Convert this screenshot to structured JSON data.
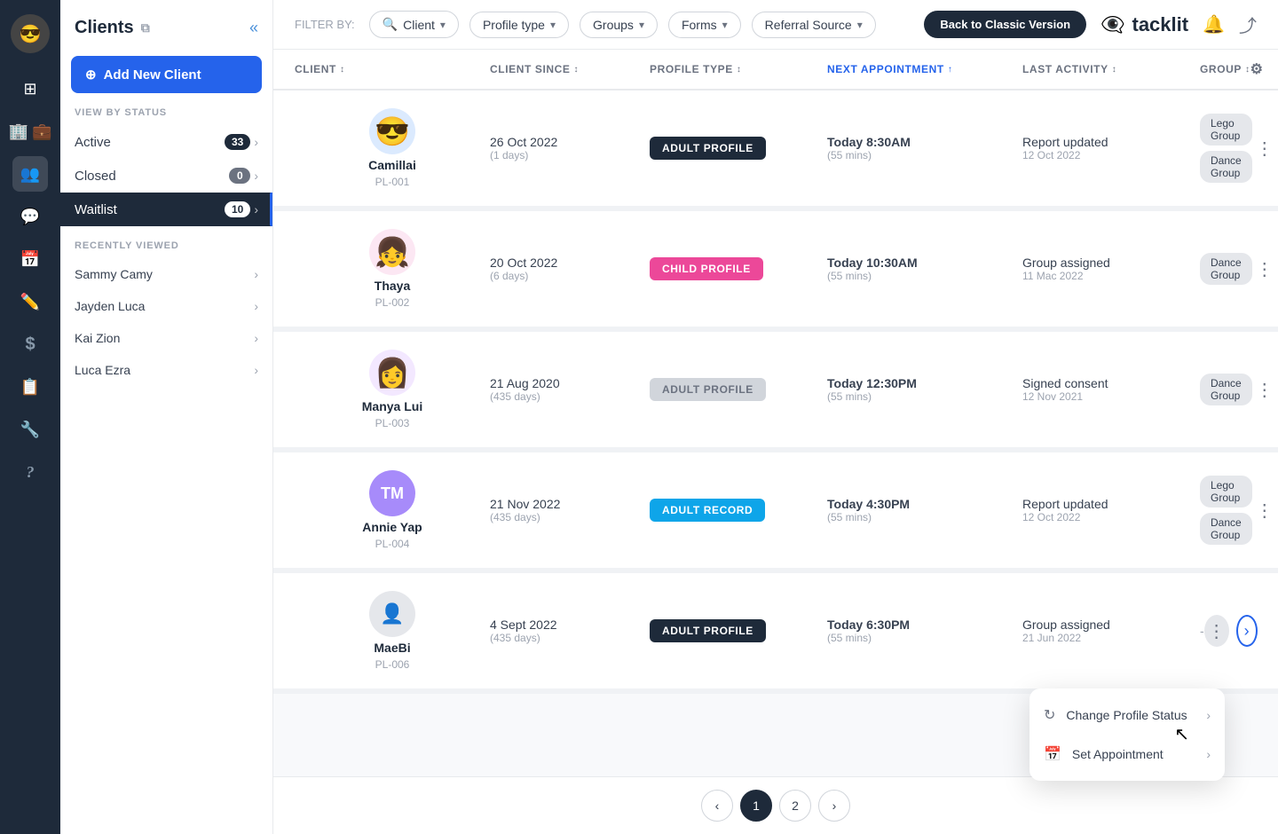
{
  "brand": {
    "name": "tacklit",
    "icon": "👁"
  },
  "nav": {
    "avatar_initial": "😎",
    "icons": [
      {
        "name": "grid-icon",
        "glyph": "⊞",
        "active": false
      },
      {
        "name": "briefcase-icon",
        "glyph": "💼",
        "active": false
      },
      {
        "name": "people-icon",
        "glyph": "👥",
        "active": true
      },
      {
        "name": "chat-icon",
        "glyph": "💬",
        "active": false
      },
      {
        "name": "calendar-icon",
        "glyph": "📅",
        "active": false
      },
      {
        "name": "pencil-icon",
        "glyph": "✏️",
        "active": false
      },
      {
        "name": "dollar-icon",
        "glyph": "$",
        "active": false
      },
      {
        "name": "list-icon",
        "glyph": "📋",
        "active": false
      },
      {
        "name": "wrench-icon",
        "glyph": "🔧",
        "active": false
      },
      {
        "name": "help-icon",
        "glyph": "?",
        "active": false
      }
    ]
  },
  "sidebar": {
    "title": "Clients",
    "add_button_label": "Add New Client",
    "view_by_status_label": "VIEW BY STATUS",
    "statuses": [
      {
        "label": "Active",
        "count": 33,
        "active": false
      },
      {
        "label": "Closed",
        "count": 0,
        "active": false
      }
    ],
    "waitlist": {
      "label": "Waitlist",
      "count": 10,
      "active": true
    },
    "recently_viewed_label": "RECENTLY VIEWED",
    "recently_viewed": [
      {
        "name": "Sammy Camy"
      },
      {
        "name": "Jayden Luca"
      },
      {
        "name": "Kai Zion"
      },
      {
        "name": "Luca Ezra"
      }
    ]
  },
  "topbar": {
    "filter_label": "FILTER BY:",
    "back_button": "Back to Classic Version",
    "filters": [
      {
        "label": "Client",
        "has_search": true
      },
      {
        "label": "Profile type"
      },
      {
        "label": "Groups"
      },
      {
        "label": "Forms"
      },
      {
        "label": "Referral Source"
      }
    ]
  },
  "table": {
    "columns": [
      {
        "label": "CLIENT",
        "key": "client",
        "sorted": false
      },
      {
        "label": "CLIENT SINCE",
        "key": "since",
        "sorted": false
      },
      {
        "label": "PROFILE TYPE",
        "key": "profile",
        "sorted": false
      },
      {
        "label": "NEXT APPOINTMENT",
        "key": "next_appt",
        "sorted": true
      },
      {
        "label": "LAST ACTIVITY",
        "key": "last_activity",
        "sorted": false
      },
      {
        "label": "GROUP",
        "key": "group",
        "sorted": false
      }
    ],
    "rows": [
      {
        "id": "row-1",
        "name": "Camillai",
        "client_id": "PL-001",
        "avatar_type": "emoji",
        "avatar": "😎",
        "avatar_bg": "#dbeafe",
        "since": "26 Oct 2022",
        "since_days": "(1 days)",
        "profile_type": "ADULT PROFILE",
        "profile_badge": "adult",
        "next_appt": "Today 8:30AM",
        "next_appt_dur": "(55 mins)",
        "last_activity": "Report updated",
        "last_activity_date": "12 Oct 2022",
        "groups": [
          "Lego Group",
          "Dance Group"
        ]
      },
      {
        "id": "row-2",
        "name": "Thaya",
        "client_id": "PL-002",
        "avatar_type": "emoji",
        "avatar": "👧",
        "avatar_bg": "#fce7f3",
        "since": "20 Oct 2022",
        "since_days": "(6 days)",
        "profile_type": "CHILD PROFILE",
        "profile_badge": "child",
        "next_appt": "Today 10:30AM",
        "next_appt_dur": "(55 mins)",
        "last_activity": "Group assigned",
        "last_activity_date": "11 Mac 2022",
        "groups": [
          "Dance Group"
        ]
      },
      {
        "id": "row-3",
        "name": "Manya Lui",
        "client_id": "PL-003",
        "avatar_type": "emoji",
        "avatar": "👩",
        "avatar_bg": "#f3e8ff",
        "since": "21 Aug 2020",
        "since_days": "(435 days)",
        "profile_type": "ADULT PROFILE",
        "profile_badge": "adult-gray",
        "next_appt": "Today 12:30PM",
        "next_appt_dur": "(55 mins)",
        "last_activity": "Signed consent",
        "last_activity_date": "12 Nov 2021",
        "groups": [
          "Dance Group"
        ]
      },
      {
        "id": "row-4",
        "name": "Annie Yap",
        "client_id": "PL-004",
        "avatar_type": "initials",
        "avatar": "TM",
        "avatar_bg": "#a78bfa",
        "since": "21 Nov 2022",
        "since_days": "(435 days)",
        "profile_type": "ADULT RECORD",
        "profile_badge": "adult-teal",
        "next_appt": "Today 4:30PM",
        "next_appt_dur": "(55 mins)",
        "last_activity": "Report updated",
        "last_activity_date": "12 Oct 2022",
        "groups": [
          "Lego Group",
          "Dance Group"
        ]
      },
      {
        "id": "row-5",
        "name": "MaeBi",
        "client_id": "PL-006",
        "avatar_type": "placeholder",
        "avatar": "",
        "avatar_bg": "#e5e7eb",
        "since": "4 Sept 2022",
        "since_days": "(435 days)",
        "profile_type": "ADULT PROFILE",
        "profile_badge": "adult",
        "next_appt": "Today 6:30PM",
        "next_appt_dur": "(55 mins)",
        "last_activity": "Group assigned",
        "last_activity_date": "21 Jun 2022",
        "groups": []
      }
    ]
  },
  "context_menu": {
    "items": [
      {
        "label": "Change Profile Status",
        "icon": "↻",
        "has_submenu": true
      },
      {
        "label": "Set Appointment",
        "icon": "📅",
        "has_submenu": true
      }
    ]
  },
  "pagination": {
    "prev_label": "‹",
    "next_label": "›",
    "pages": [
      {
        "number": "1",
        "active": true
      },
      {
        "number": "2",
        "active": false
      }
    ]
  }
}
